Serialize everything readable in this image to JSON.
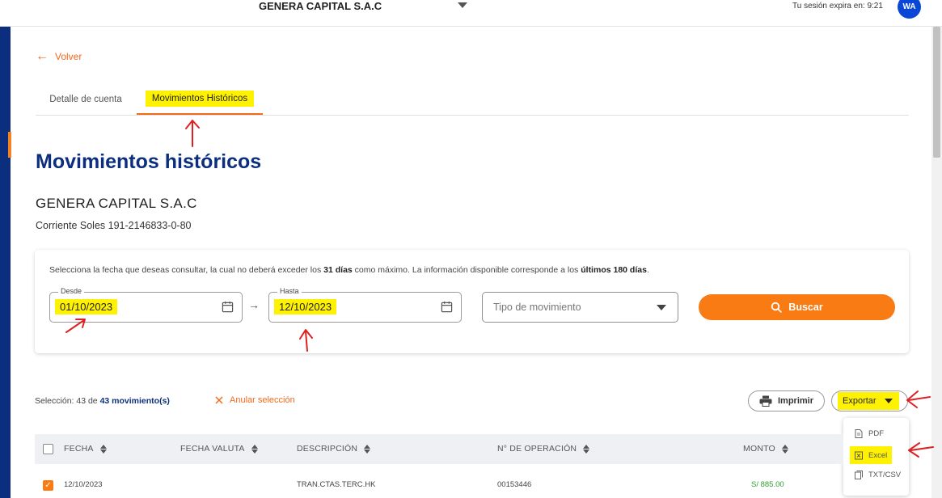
{
  "topbar": {
    "company": "GENERA CAPITAL S.A.C",
    "session": "Tu sesión expira en: 9:21",
    "avatar": "WA"
  },
  "back_link": "Volver",
  "tabs": [
    {
      "label": "Detalle de cuenta",
      "active": false
    },
    {
      "label": "Movimientos Históricos",
      "active": true
    }
  ],
  "page_title": "Movimientos históricos",
  "company_name": "GENERA CAPITAL S.A.C",
  "account": "Corriente Soles 191-2146833-0-80",
  "filter": {
    "info_prefix": "Selecciona la fecha que deseas consultar, la cual no deberá exceder los ",
    "info_days": "31 días",
    "info_middle": " como máximo. La información disponible corresponde a los ",
    "info_last": "últimos 180 días",
    "info_suffix": ".",
    "desde_label": "Desde",
    "desde_value": "01/10/2023",
    "hasta_label": "Hasta",
    "hasta_value": "12/10/2023",
    "tipo_placeholder": "Tipo de movimiento",
    "search_label": "Buscar"
  },
  "selection": {
    "prefix": "Selección: 43 de ",
    "count": "43 movimiento(s)",
    "clear_label": "Anular selección"
  },
  "actions": {
    "print_label": "Imprimir",
    "export_label": "Exportar"
  },
  "export_menu": [
    "PDF",
    "Excel",
    "TXT/CSV"
  ],
  "table": {
    "headers": [
      "FECHA",
      "FECHA VALUTA",
      "DESCRIPCIÓN",
      "N° DE OPERACIÓN",
      "MONTO"
    ],
    "rows": [
      {
        "fecha": "12/10/2023",
        "valuta": "",
        "descripcion": "TRAN.CTAS.TERC.HK",
        "operacion": "00153446",
        "monto": "S/ 885.00"
      }
    ]
  },
  "colors": {
    "brand_blue": "#0b2f7e",
    "accent_orange": "#f97b14",
    "highlight_yellow": "#fff200",
    "annotation_red": "#e02020",
    "amount_green": "#2e9e33"
  }
}
